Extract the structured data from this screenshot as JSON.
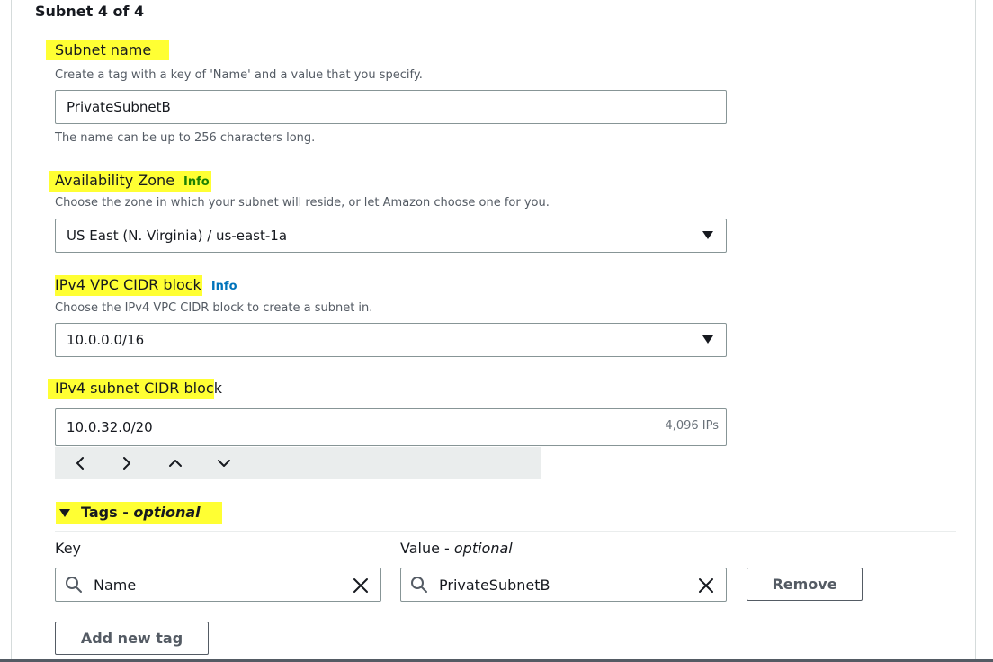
{
  "section_title": "Subnet 4 of 4",
  "subnet_name": {
    "label": "Subnet name",
    "description": "Create a tag with a key of 'Name' and a value that you specify.",
    "value": "PrivateSubnetB",
    "hint": "The name can be up to 256 characters long."
  },
  "availability_zone": {
    "label": "Availability Zone",
    "info": "Info",
    "description": "Choose the zone in which your subnet will reside, or let Amazon choose one for you.",
    "selected": "US East (N. Virginia) / us-east-1a"
  },
  "vpc_cidr": {
    "label": "IPv4 VPC CIDR block",
    "info": "Info",
    "description": "Choose the IPv4 VPC CIDR block to create a subnet in.",
    "selected": "10.0.0.0/16"
  },
  "subnet_cidr": {
    "label_highlighted": "IPv4 subnet CIDR bloc",
    "label_rest": "k",
    "value": "10.0.32.0/20",
    "ip_count": "4,096 IPs"
  },
  "tags": {
    "heading": "Tags - ",
    "heading_optional": "optional",
    "key_header": "Key",
    "value_header": "Value - ",
    "value_header_optional": "optional",
    "rows": [
      {
        "key": "Name",
        "value": "PrivateSubnetB",
        "remove_label": "Remove"
      }
    ],
    "add_label": "Add new tag"
  },
  "colors": {
    "highlight": "#ffff33",
    "info_green": "#1d8102",
    "info_blue": "#0073bb"
  },
  "icons": [
    "chevron-left-icon",
    "chevron-right-icon",
    "chevron-up-icon",
    "chevron-down-icon",
    "search-icon",
    "clear-icon",
    "caret-down-icon",
    "expanded-caret-icon"
  ]
}
